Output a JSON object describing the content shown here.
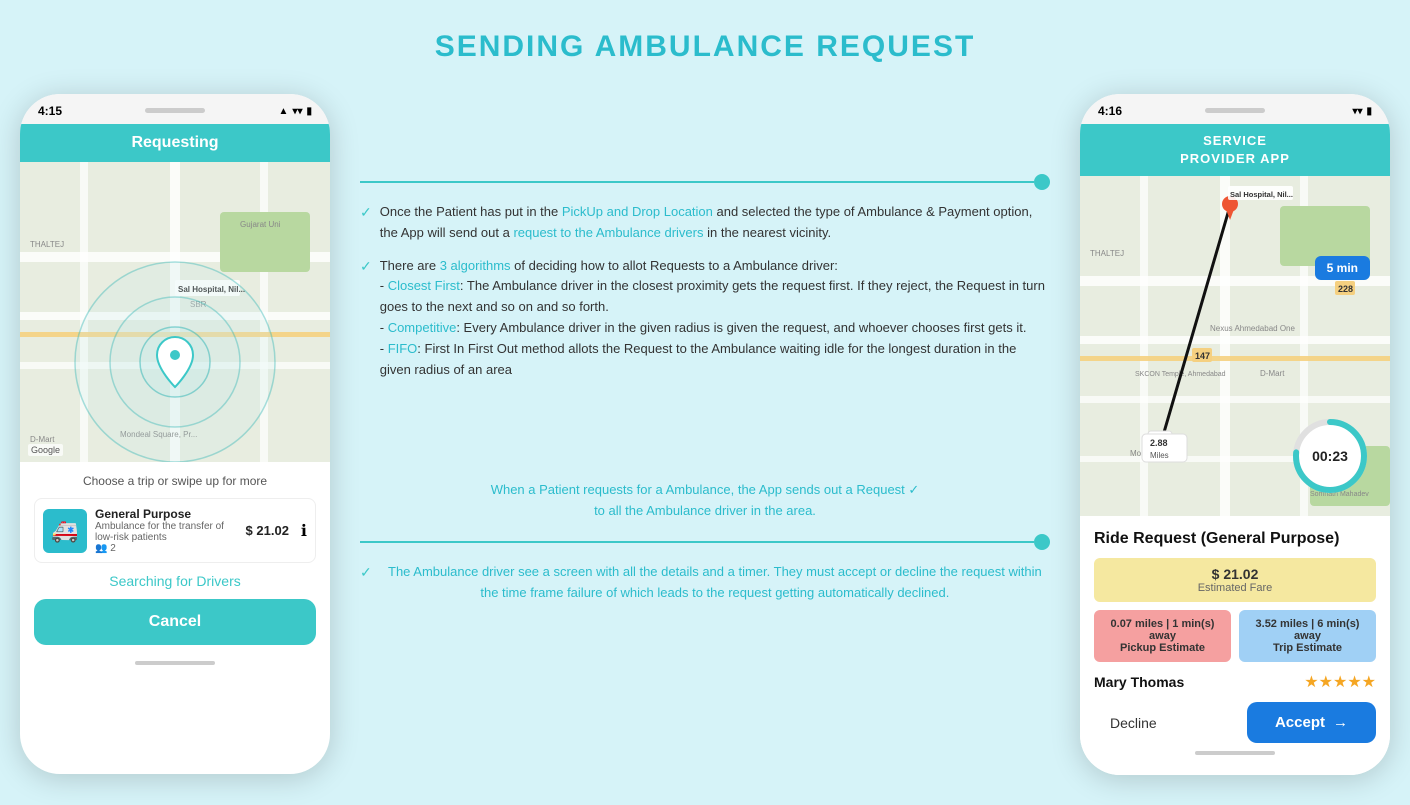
{
  "page": {
    "title": "SENDING AMBULANCE REQUEST",
    "background": "#d6f3f8"
  },
  "left_phone": {
    "status_time": "4:15",
    "header": "Requesting",
    "choose_text": "Choose a trip or swipe up for more",
    "ambulance_card": {
      "name": "General Purpose",
      "description": "Ambulance for the transfer of low-risk patients",
      "passengers": "2",
      "price": "$ 21.02"
    },
    "searching_text": "Searching for Drivers",
    "cancel_label": "Cancel"
  },
  "right_phone": {
    "status_time": "4:16",
    "header_line1": "SERVICE",
    "header_line2": "PROVIDER APP",
    "time_badge": "5 min",
    "distance_label": "2.88\nMiles",
    "timer": "00:23",
    "ride_request": {
      "title": "Ride Request (General Purpose)",
      "fare": "$ 21.02",
      "fare_label": "Estimated Fare",
      "pickup_estimate": "0.07 miles | 1 min(s) away\nPickup Estimate",
      "trip_estimate": "3.52 miles | 6 min(s) away\nTrip Estimate",
      "driver_name": "Mary Thomas",
      "stars": "★★★★★",
      "decline_label": "Decline",
      "accept_label": "Accept"
    }
  },
  "annotations": {
    "top_items": [
      "Once the Patient has put in the PickUp and Drop Location and selected the type of Ambulance & Payment option, the App will send out a request to the Ambulance drivers in the nearest vicinity.",
      "There are 3 algorithms of deciding how to allot Requests to a Ambulance driver:\n- Closest First: The Ambulance driver in the closest proximity gets the request first. If they reject, the Request in turn goes to the next and so on and so forth.\n- Competitive: Every Ambulance driver in the given radius is given the request, and whoever chooses first gets it.\n- FIFO: First In First Out method allots the Request to the Ambulance waiting idle for the longest duration in the given radius of an area"
    ],
    "bottom_items": [
      "When a Patient requests for a Ambulance, the App sends out a Request to all the Ambulance driver in the area.",
      "The Ambulance driver see a screen with all the details and a timer. They must accept or decline the request within the time frame failure of which leads to the request getting automatically declined."
    ]
  }
}
